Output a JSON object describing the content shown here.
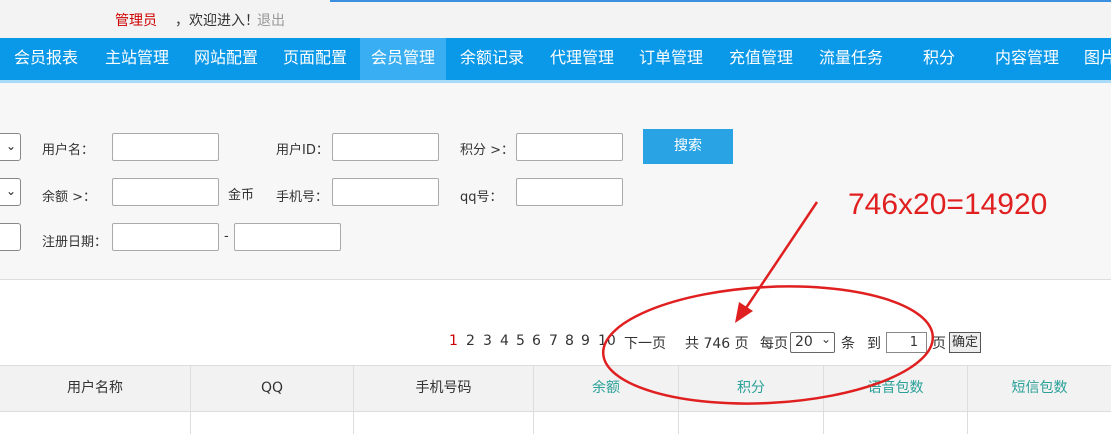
{
  "header": {
    "admin": "管理员",
    "welcome": "，欢迎进入！",
    "logout": "退出"
  },
  "nav": {
    "items": [
      "会员报表",
      "主站管理",
      "网站配置",
      "页面配置",
      "会员管理",
      "余额记录",
      "代理管理",
      "订单管理",
      "充值管理",
      "流量任务",
      "积分",
      "内容管理",
      "图片"
    ],
    "active_index": 4
  },
  "filter": {
    "username_label": "用户名：",
    "userid_label": "用户ID：",
    "points_label": "积分 >：",
    "balance_label": "余额 >：",
    "balance_unit": "金币",
    "phone_label": "手机号：",
    "qq_label": "qq号：",
    "regdate_label": "注册日期：",
    "date_sep": "-",
    "search_button": "搜索"
  },
  "annotation": {
    "text": "746x20=14920"
  },
  "pagination": {
    "pages": [
      "1",
      "2",
      "3",
      "4",
      "5",
      "6",
      "7",
      "8",
      "9",
      "10"
    ],
    "current": "1",
    "next": "下一页",
    "total": "共 746 页",
    "per_page_label": "每页",
    "per_page_value": "20",
    "per_page_unit": "条",
    "goto_label": "到",
    "goto_value": "1",
    "page_unit": "页",
    "confirm": "确定"
  },
  "table": {
    "columns": [
      "用户名称",
      "QQ",
      "手机号码",
      "余额",
      "积分",
      "语音包数",
      "短信包数"
    ],
    "column_colors": [
      "#333333",
      "#333333",
      "#333333",
      "#2aa198",
      "#2aa198",
      "#2aa198",
      "#2aa198"
    ]
  },
  "colors": {
    "nav_bg": "#0a98e8",
    "nav_active": "#3aaef2",
    "search_btn": "#29a3e3",
    "annotation": "#e02020"
  }
}
